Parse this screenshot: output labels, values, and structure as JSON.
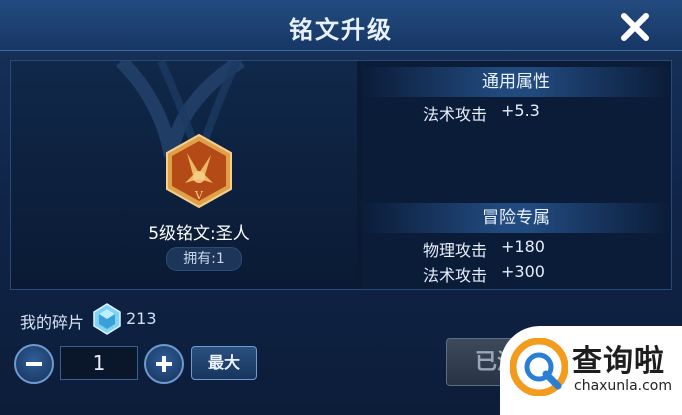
{
  "window": {
    "title": "铭文升级"
  },
  "rune": {
    "name": "5级铭文:圣人",
    "owned": "拥有:1",
    "icon": "rune-badge-icon",
    "accent_color": "#c8641f"
  },
  "general_attributes": {
    "header": "通用属性",
    "stats": [
      {
        "label": "法术攻击",
        "value": "+5.3"
      }
    ]
  },
  "adventure_exclusive": {
    "header": "冒险专属",
    "stats": [
      {
        "label": "物理攻击",
        "value": "+180"
      },
      {
        "label": "法术攻击",
        "value": "+300"
      }
    ]
  },
  "fragments": {
    "label": "我的碎片",
    "count": "213",
    "icon": "crystal-icon"
  },
  "controls": {
    "quantity": "1",
    "max_label": "最大",
    "upgrade_label": "已满"
  },
  "watermark": {
    "cn": "查询啦",
    "en": "chaxunla.com"
  }
}
